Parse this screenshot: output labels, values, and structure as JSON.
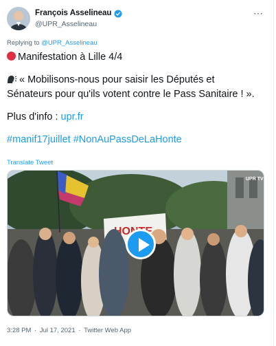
{
  "author": {
    "display_name": "François Asselineau",
    "handle": "@UPR_Asselineau"
  },
  "reply": {
    "prefix": "Replying to",
    "handle": "@UPR_Asselineau"
  },
  "tweet": {
    "line1": "Manifestation à Lille 4/4",
    "line2": "« Mobilisons-nous pour saisir les Députés et",
    "line3": "Sénateurs pour qu'ils votent contre le Pass Sanitaire ! ».",
    "info_label": "Plus d'info : ",
    "info_link": "upr.fr",
    "hashtag1": "#manif17juillet",
    "hashtag2": "#NonAuPassDeLaHonte"
  },
  "translate_label": "Translate Tweet",
  "media": {
    "banner_text": "HONTE",
    "watermark": "UPR TV"
  },
  "meta": {
    "time": "3:28 PM",
    "separator1": " · ",
    "date": "Jul 17, 2021",
    "separator2": " · ",
    "source": "Twitter Web App"
  },
  "colors": {
    "accent": "#1d9bf0",
    "text": "#0f1419",
    "secondary": "#536471",
    "red_dot": "#dd2e44"
  },
  "icons": [
    "verified-badge-icon",
    "more-options-icon",
    "red-circle-icon",
    "speaking-head-icon",
    "play-icon"
  ]
}
